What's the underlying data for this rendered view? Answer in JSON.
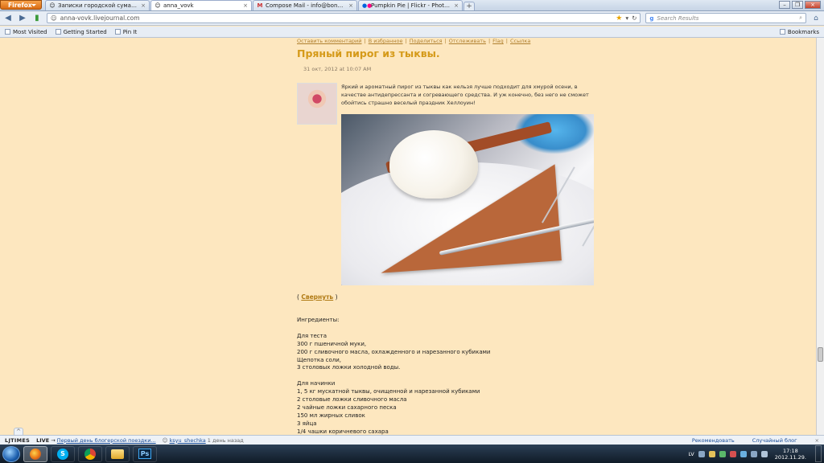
{
  "browser": {
    "menu_button": "Firefox",
    "tabs": [
      {
        "title": "Записки городской сумасшедшей - ...",
        "icon": "livejournal-icon",
        "active": false
      },
      {
        "title": "anna_vovk",
        "icon": "livejournal-icon",
        "active": true
      },
      {
        "title": "Compose Mail - info@bonappetit.lv - ...",
        "icon": "gmail-icon",
        "active": false
      },
      {
        "title": "Pumpkin Pie | Flickr - Photo Sharing!",
        "icon": "flickr-icon",
        "active": false
      }
    ],
    "new_tab": "+",
    "url": "anna-vovk.livejournal.com",
    "search_placeholder": "Search Results",
    "bookmarks": [
      "Most Visited",
      "Getting Started",
      "Pin It"
    ],
    "bookmarks_menu": "Bookmarks"
  },
  "post": {
    "actions": [
      "Оставить комментарий",
      "|",
      "В избранное",
      "|",
      "Поделиться",
      "|",
      "Отслеживать",
      "|",
      "Flag",
      "|",
      "Ссылка"
    ],
    "title": "Пряный пирог из тыквы.",
    "date": "31 окт, 2012 at 10:07 AM",
    "lead": "Яркий и ароматный пирог из тыквы как нельзя лучше подходит для хмурой осени, в качестве антидепрессанта и согревающего средства. И уж конечно, без него не сможет обойтись страшно веселый праздник Хеллоуин!",
    "toggle_open": "( ",
    "toggle_link": "Свернуть",
    "toggle_close": " )",
    "ingredients_heading": "Ингредиенты:",
    "dough_heading": "Для теста",
    "dough": [
      "300 г пшеничной муки,",
      "200 г сливочного масла, охлажденного и нарезанного кубиками",
      "Щепотка соли,",
      "3 столовых ложки холодной воды."
    ],
    "filling_heading": "Для начинки",
    "filling": [
      "1, 5 кг мускатной тыквы, очищенной и нарезанной кубиками",
      "2 столовые ложки сливочного масла",
      "2 чайные ложки сахарного песка",
      "150 мл жирных сливок",
      "3 яйца",
      "1/4 чашки коричневого сахара"
    ]
  },
  "lj_bar": {
    "logo": "LJTIMES",
    "live": "LIVE",
    "arrow": "→",
    "headline": "Первый день блогерской поездки...",
    "user": "ksyu_shechka",
    "user_time": "1 день назад",
    "recommend": "Рекомендовать",
    "random": "Случайный блог",
    "close": "×",
    "up": "^"
  },
  "taskbar": {
    "apps": [
      {
        "name": "firefox-app",
        "active": true
      },
      {
        "name": "skype-app",
        "label": "S"
      },
      {
        "name": "chrome-app"
      },
      {
        "name": "explorer-app"
      },
      {
        "name": "photoshop-app",
        "label": "Ps"
      }
    ],
    "language": "LV",
    "time": "17:18",
    "date": "2012.11.29."
  },
  "colors": {
    "page_bg": "#fde7bf",
    "title": "#d59a19",
    "link": "#b07a14"
  }
}
